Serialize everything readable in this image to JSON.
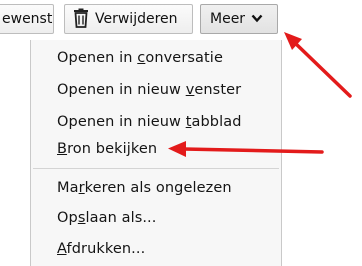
{
  "toolbar": {
    "forward_label": "ewenst",
    "delete_label": "Verwijderen",
    "more_label": "Meer"
  },
  "menu": {
    "items": [
      {
        "pre": "Openen in ",
        "u": "c",
        "post": "onversatie"
      },
      {
        "pre": "Openen in nieuw ",
        "u": "v",
        "post": "enster"
      },
      {
        "pre": "Openen in nieuw ",
        "u": "t",
        "post": "abblad"
      },
      {
        "pre": "",
        "u": "B",
        "post": "ron bekijken"
      },
      {
        "pre": "Ma",
        "u": "r",
        "post": "keren als ongelezen"
      },
      {
        "pre": "Op",
        "u": "s",
        "post": "laan als..."
      },
      {
        "pre": "",
        "u": "A",
        "post": "fdrukken..."
      }
    ]
  },
  "icons": {
    "delete": "trash-icon",
    "more": "chevron-down-icon"
  },
  "colors": {
    "annotation_arrow": "#e31b1b",
    "menu_background": "#f7f7f7"
  }
}
